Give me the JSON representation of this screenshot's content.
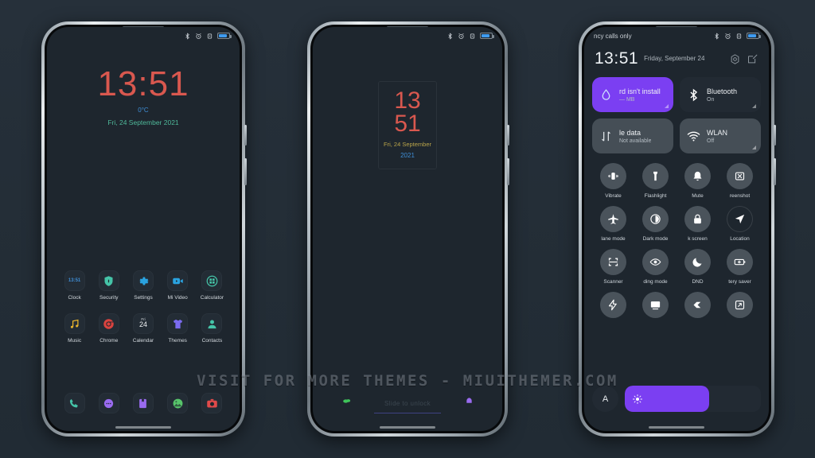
{
  "watermark": "VISIT FOR MORE THEMES - MIUITHEMER.COM",
  "statusbar": {
    "bluetooth_icon": "bluetooth-icon",
    "alarm_icon": "alarm-icon",
    "vibrate_icon": "vibrate-icon",
    "battery_icon": "battery-icon"
  },
  "phone1": {
    "name": "lock-home-screen",
    "time": "13:51",
    "temperature": "0°C",
    "date": "Fri, 24 September 2021",
    "apps": [
      {
        "label": "Clock",
        "icon": "clock-icon",
        "badge": "13:51"
      },
      {
        "label": "Security",
        "icon": "shield-icon"
      },
      {
        "label": "Settings",
        "icon": "gear-icon"
      },
      {
        "label": "Mi Video",
        "icon": "video-icon"
      },
      {
        "label": "Calculator",
        "icon": "calculator-icon"
      },
      {
        "label": "Music",
        "icon": "music-note-icon"
      },
      {
        "label": "Chrome",
        "icon": "chrome-icon"
      },
      {
        "label": "Calendar",
        "icon": "calendar-icon",
        "day_name": "Fri",
        "day_num": "24"
      },
      {
        "label": "Themes",
        "icon": "tshirt-icon"
      },
      {
        "label": "Contacts",
        "icon": "person-icon"
      }
    ],
    "dock": [
      {
        "label": "Phone",
        "icon": "phone-icon"
      },
      {
        "label": "Messages",
        "icon": "messages-icon"
      },
      {
        "label": "File Manager",
        "icon": "file-manager-icon"
      },
      {
        "label": "Gallery",
        "icon": "gallery-icon"
      },
      {
        "label": "Camera",
        "icon": "camera-icon"
      }
    ]
  },
  "phone2": {
    "name": "lock-screen-widget",
    "hour": "13",
    "minute": "51",
    "date": "Fri, 24 September",
    "year": "2021",
    "unlock_hint": "Slide to unlock",
    "left_icon": "camera-shortcut-icon",
    "right_icon": "notification-shortcut-icon"
  },
  "phone3": {
    "name": "control-center",
    "carrier": "ncy calls only",
    "time": "13:51",
    "date": "Friday, September 24",
    "settings_icon": "gear-icon",
    "edit_icon": "edit-icon",
    "big_tiles": [
      {
        "title": "rd isn't install",
        "subtitle": "— MB",
        "icon": "sim-data-icon",
        "state": "on"
      },
      {
        "title": "Bluetooth",
        "subtitle": "On",
        "icon": "bluetooth-icon",
        "state": "off"
      },
      {
        "title": "le data",
        "subtitle": "Not available",
        "icon": "mobile-data-icon",
        "state": "dim"
      },
      {
        "title": "WLAN",
        "subtitle": "Off",
        "icon": "wifi-icon",
        "state": "dim"
      }
    ],
    "toggles": [
      {
        "label": "Vibrate",
        "icon": "vibrate-icon",
        "active": false
      },
      {
        "label": "Flashlight",
        "icon": "flashlight-icon",
        "active": false
      },
      {
        "label": "Mute",
        "icon": "bell-icon",
        "active": false
      },
      {
        "label": "reenshot",
        "icon": "screenshot-icon",
        "active": false
      },
      {
        "label": "lane mode",
        "icon": "airplane-icon",
        "active": false
      },
      {
        "label": "Dark mode",
        "icon": "dark-mode-icon",
        "active": false
      },
      {
        "label": "k screen",
        "icon": "lock-icon",
        "active": false
      },
      {
        "label": "Location",
        "icon": "location-icon",
        "active": true
      },
      {
        "label": "Scanner",
        "icon": "scanner-icon",
        "active": false
      },
      {
        "label": "ding mode",
        "icon": "eye-icon",
        "active": false
      },
      {
        "label": "DND",
        "icon": "moon-icon",
        "active": false
      },
      {
        "label": "tery saver",
        "icon": "battery-saver-icon",
        "active": false
      },
      {
        "label": "",
        "icon": "lightning-icon",
        "active": false
      },
      {
        "label": "",
        "icon": "cast-icon",
        "active": false
      },
      {
        "label": "",
        "icon": "contrast-icon",
        "active": false
      },
      {
        "label": "",
        "icon": "rotate-icon",
        "active": false
      }
    ],
    "brightness": {
      "auto_label": "A",
      "level_percent": 62,
      "sun_icon": "sun-icon"
    }
  },
  "colors": {
    "background": "#252f38",
    "screen": "#1e262e",
    "accent_purple": "#7b3ff2",
    "clock_red": "#d9584f",
    "teal": "#45c4a8",
    "blue": "#3f8ed6",
    "green": "#4fb99a",
    "yellow": "#b9a44a"
  }
}
